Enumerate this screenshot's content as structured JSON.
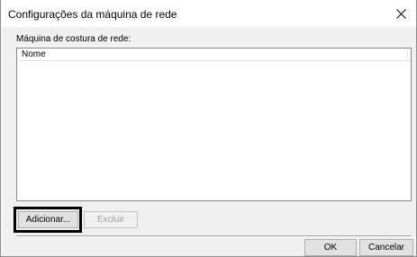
{
  "dialog": {
    "title": "Configurações da máquina de rede",
    "close_icon": "close-icon"
  },
  "section": {
    "label": "Máquina de costura de rede:"
  },
  "list": {
    "columns": [
      "Nome"
    ],
    "rows": []
  },
  "buttons": {
    "add_label": "Adicionar...",
    "delete_label": "Excluir",
    "ok_label": "OK",
    "cancel_label": "Cancelar"
  }
}
